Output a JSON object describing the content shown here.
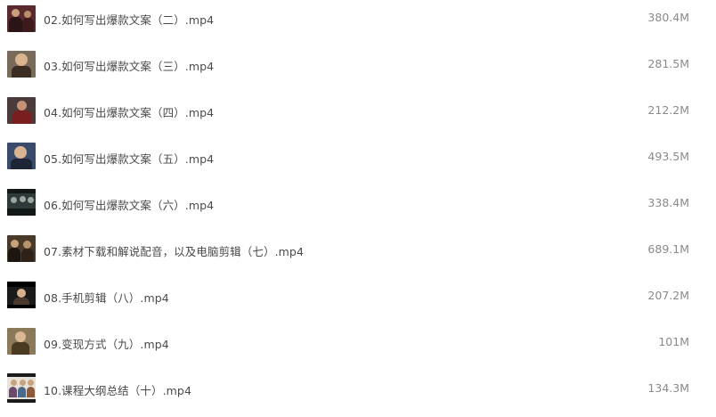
{
  "files": [
    {
      "name": "02.如何写出爆款文案（二）.mp4",
      "size": "380.4M",
      "thumb": {
        "bg": "#5a2a2e",
        "accent": "#c9a07a",
        "dark": "#2a1416"
      }
    },
    {
      "name": "03.如何写出爆款文案（三）.mp4",
      "size": "281.5M",
      "thumb": {
        "bg": "#7a6a5a",
        "accent": "#d9b48f",
        "dark": "#3b2d22"
      }
    },
    {
      "name": "04.如何写出爆款文案（四）.mp4",
      "size": "212.2M",
      "thumb": {
        "bg": "#4a3a3a",
        "accent": "#c69275",
        "dark": "#7a1f1f"
      }
    },
    {
      "name": "05.如何写出爆款文案（五）.mp4",
      "size": "493.5M",
      "thumb": {
        "bg": "#3a4a6a",
        "accent": "#d8b493",
        "dark": "#1e2536"
      }
    },
    {
      "name": "06.如何写出爆款文案（六）.mp4",
      "size": "338.4M",
      "thumb": {
        "bg": "#2e3a3a",
        "accent": "#9aa7a0",
        "dark": "#121818"
      }
    },
    {
      "name": "07.素材下载和解说配音，以及电脑剪辑（七）.mp4",
      "size": "689.1M",
      "thumb": {
        "bg": "#4a3a2a",
        "accent": "#c7a27a",
        "dark": "#1c1510"
      }
    },
    {
      "name": "08.手机剪辑（八）.mp4",
      "size": "207.2M",
      "thumb": {
        "bg": "#1a1a1a",
        "accent": "#d8b08c",
        "dark": "#000000"
      }
    },
    {
      "name": "09.变现方式（九）.mp4",
      "size": "101M",
      "thumb": {
        "bg": "#8a7a5a",
        "accent": "#d9b896",
        "dark": "#4a3a22"
      }
    },
    {
      "name": "10.课程大纲总结（十）.mp4",
      "size": "134.3M",
      "thumb": {
        "bg": "#e8e2da",
        "accent": "#c8a27c",
        "dark": "#1a1a1a"
      }
    }
  ]
}
